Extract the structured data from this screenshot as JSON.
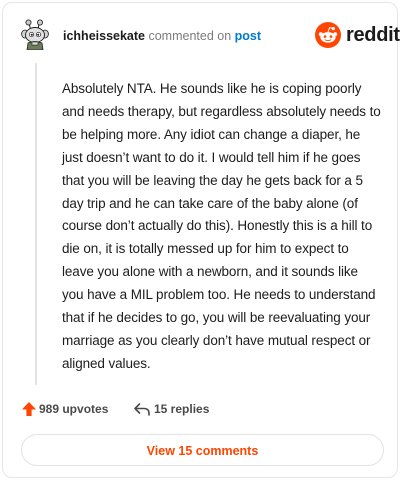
{
  "header": {
    "username": "ichheissekate",
    "action_text": "commented on",
    "post_link": "post",
    "avatar_icon": "snoo-avatar-icon"
  },
  "brand": {
    "wordmark": "reddit",
    "logo_icon": "reddit-logo-icon",
    "color": "#ff4500"
  },
  "comment": {
    "text": "Absolutely NTA. He sounds like he is coping poorly and needs therapy, but regardless absolutely needs to be helping more. Any idiot can change a diaper, he just doesn’t want to do it. I would tell him if he goes that you will be leaving the day he gets back for a 5 day trip and he can take care of the baby alone (of course don’t actually do this). Honestly this is a hill to die on, it is totally messed up for him to expect to leave you alone with a newborn, and it sounds like you have a MIL problem too. He needs to understand that if he decides to go, you will be reevaluating your marriage as you clearly don’t have mutual respect or aligned values."
  },
  "actions": {
    "upvotes_label": "989 upvotes",
    "upvote_icon": "upvote-arrow-icon",
    "upvote_color": "#ff4500",
    "replies_label": "15 replies",
    "reply_icon": "reply-arrow-icon"
  },
  "footer": {
    "view_comments_label": "View 15 comments"
  }
}
